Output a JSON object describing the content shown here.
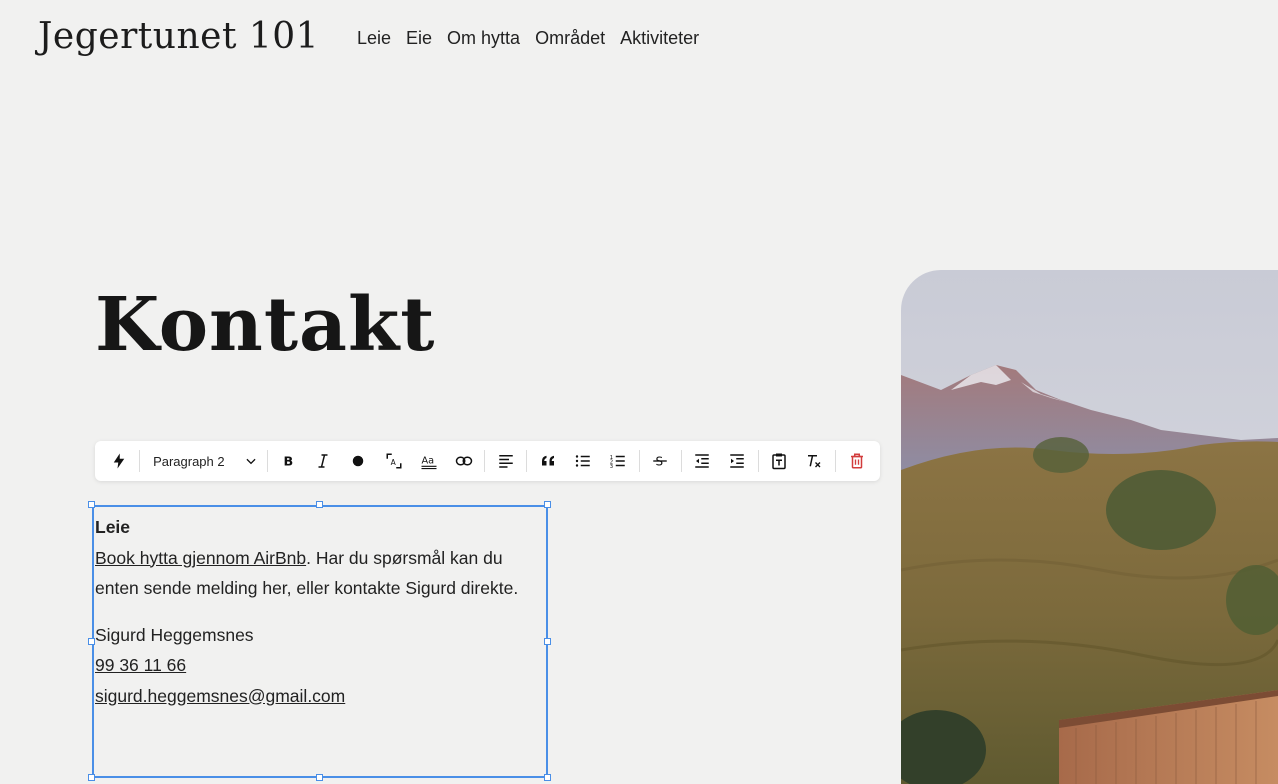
{
  "site": {
    "logo": "Jegertunet 101"
  },
  "nav": [
    "Leie",
    "Eie",
    "Om hytta",
    "Området",
    "Aktiviteter"
  ],
  "page": {
    "title": "Kontakt"
  },
  "toolbar": {
    "paragraph_style": "Paragraph 2",
    "icons": [
      "lightning-icon",
      "bold-icon",
      "italic-icon",
      "color-dot-icon",
      "text-size-icon",
      "text-style-icon",
      "link-icon",
      "align-left-icon",
      "quote-icon",
      "bullet-list-icon",
      "numbered-list-icon",
      "strikethrough-icon",
      "outdent-icon",
      "indent-icon",
      "paste-text-icon",
      "clear-format-icon",
      "trash-icon"
    ],
    "delete_color": "#d23c3c"
  },
  "content": {
    "heading": "Leie",
    "airbnb_link": "Book hytta gjennom AirBnb",
    "intro_rest": ". Har du spørsmål kan du enten sende melding her, eller kontakte Sigurd direkte.",
    "contact_name": "Sigurd Heggemsnes",
    "phone": "99 36 11 66",
    "email": "sigurd.heggemsnes@gmail.com"
  },
  "colors": {
    "accent": "#4a8fe7",
    "background": "#f1f1f0"
  }
}
